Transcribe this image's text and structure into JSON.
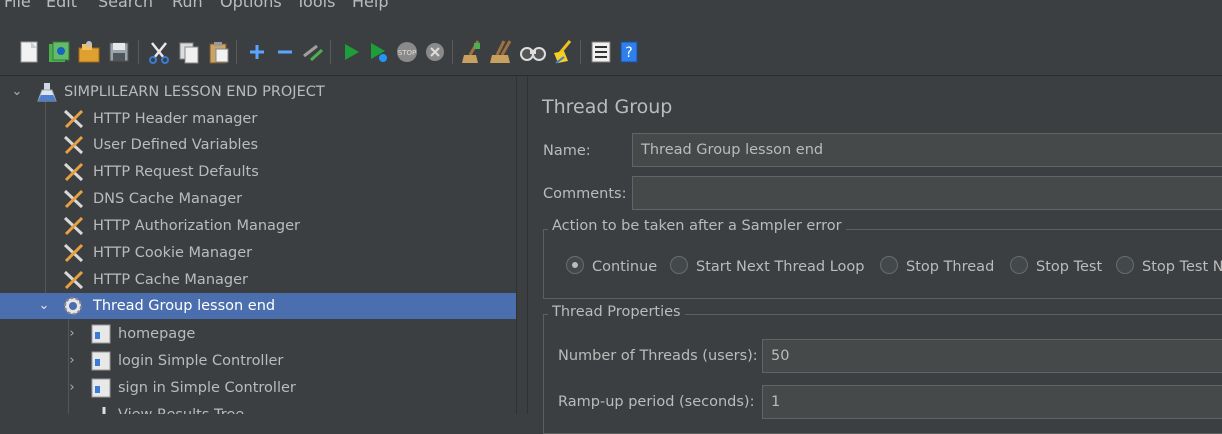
{
  "menubar": {
    "items": [
      "File",
      "Edit",
      "Search",
      "Run",
      "Options",
      "Tools",
      "Help"
    ]
  },
  "toolbar": {
    "buttons": [
      "new-icon",
      "templates-icon",
      "open-icon",
      "save-icon",
      "cut-icon",
      "copy-icon",
      "paste-icon",
      "expand-icon",
      "collapse-icon",
      "toggle-icon",
      "start-icon",
      "start-no-pauses-icon",
      "stop-icon",
      "shutdown-icon",
      "clear-icon",
      "clear-all-icon",
      "search-icon",
      "reset-search-icon",
      "function-helper-icon",
      "help-icon"
    ],
    "accent": "#1e9e3a"
  },
  "tree": {
    "root": "SIMPLILEARN LESSON END PROJECT",
    "config_items": [
      "HTTP Header manager",
      "User Defined Variables",
      "HTTP Request Defaults",
      "DNS Cache Manager",
      "HTTP Authorization Manager",
      "HTTP Cookie Manager",
      "HTTP Cache Manager"
    ],
    "thread_group": "Thread Group lesson end",
    "controllers": [
      "homepage",
      "login Simple Controller",
      "sign in Simple Controller"
    ],
    "partial_item": "View Results Tree",
    "selected_color": "#4b6eaf"
  },
  "panel": {
    "title": "Thread Group",
    "name_label": "Name:",
    "name_value": "Thread Group lesson end",
    "comments_label": "Comments:",
    "comments_value": "",
    "error_group_label": "Action to be taken after a Sampler error",
    "error_actions": [
      {
        "label": "Continue",
        "selected": true
      },
      {
        "label": "Start Next Thread Loop",
        "selected": false
      },
      {
        "label": "Stop Thread",
        "selected": false
      },
      {
        "label": "Stop Test",
        "selected": false
      },
      {
        "label": "Stop Test Now",
        "selected": false
      }
    ],
    "thread_props_label": "Thread Properties",
    "threads_label": "Number of Threads (users):",
    "threads_value": "50",
    "rampup_label": "Ramp-up period (seconds):",
    "rampup_value": "1"
  }
}
